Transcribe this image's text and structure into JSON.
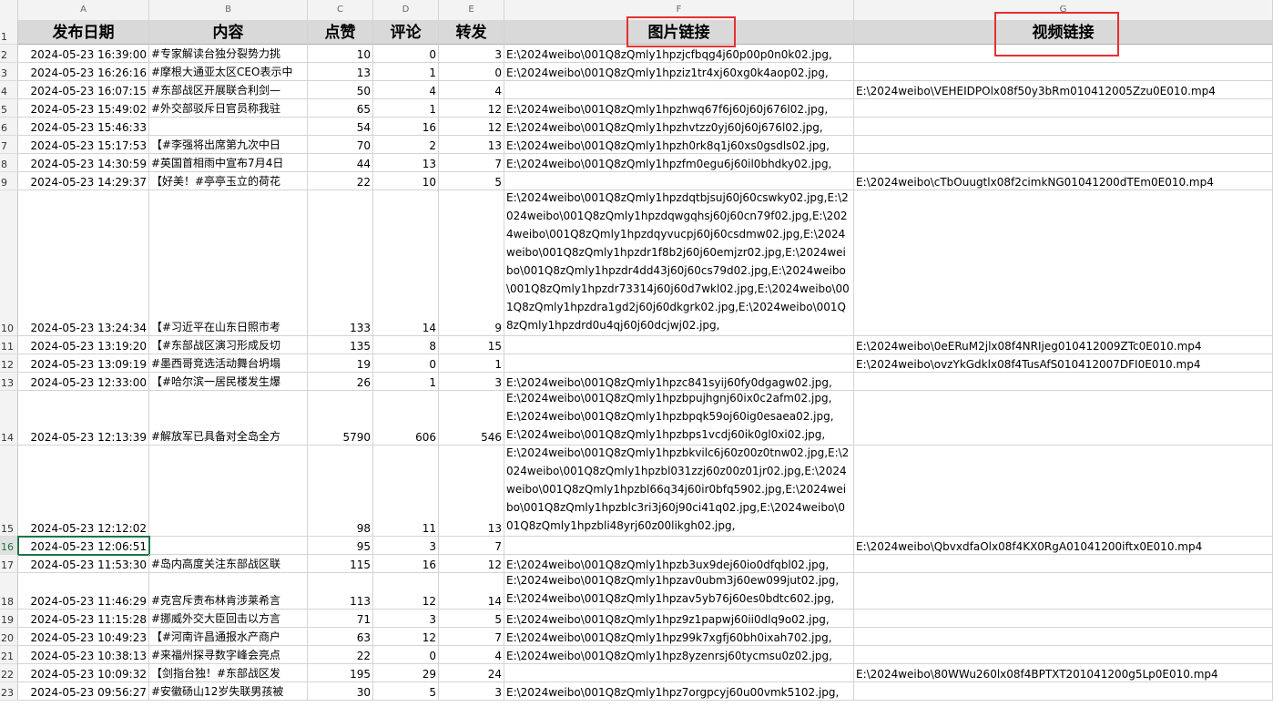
{
  "columns": [
    {
      "letter": "A"
    },
    {
      "letter": "B"
    },
    {
      "letter": "C"
    },
    {
      "letter": "D"
    },
    {
      "letter": "E"
    },
    {
      "letter": "F"
    },
    {
      "letter": "G"
    }
  ],
  "header_row": {
    "row": "1",
    "cells": [
      "发布日期",
      "内容",
      "点赞",
      "评论",
      "转发",
      "图片链接",
      "视频链接"
    ]
  },
  "rows": [
    {
      "row": "2",
      "date": "2024-05-23 16:39:00",
      "content": "#专家解读台独分裂势力挑",
      "likes": "10",
      "comments": "0",
      "reposts": "3",
      "images": "E:\\2024weibo\\001Q8zQmly1hpzjcfbqg4j60p00p0n0k02.jpg,",
      "video": ""
    },
    {
      "row": "3",
      "date": "2024-05-23 16:26:16",
      "content": "#摩根大通亚太区CEO表示中",
      "likes": "13",
      "comments": "1",
      "reposts": "0",
      "images": "E:\\2024weibo\\001Q8zQmly1hpziz1tr4xj60xg0k4aop02.jpg,",
      "video": ""
    },
    {
      "row": "4",
      "date": "2024-05-23 16:07:15",
      "content": "#东部战区开展联合利剑—",
      "likes": "50",
      "comments": "4",
      "reposts": "4",
      "images": "",
      "video": "E:\\2024weibo\\VEHEIDPOlx08f50y3bRm010412005Zzu0E010.mp4"
    },
    {
      "row": "5",
      "date": "2024-05-23 15:49:02",
      "content": "#外交部驳斥日官员称我驻",
      "likes": "65",
      "comments": "1",
      "reposts": "12",
      "images": "E:\\2024weibo\\001Q8zQmly1hpzhwq67f6j60j60j676l02.jpg,",
      "video": ""
    },
    {
      "row": "6",
      "date": "2024-05-23 15:46:33",
      "content": "",
      "likes": "54",
      "comments": "16",
      "reposts": "12",
      "images": "E:\\2024weibo\\001Q8zQmly1hpzhvtzz0yj60j60j676l02.jpg,",
      "video": ""
    },
    {
      "row": "7",
      "date": "2024-05-23 15:17:53",
      "content": "【#李强将出席第九次中日",
      "likes": "70",
      "comments": "2",
      "reposts": "13",
      "images": "E:\\2024weibo\\001Q8zQmly1hpzh0rk8q1j60xs0gsdls02.jpg,",
      "video": ""
    },
    {
      "row": "8",
      "date": "2024-05-23 14:30:59",
      "content": "#英国首相雨中宣布7月4日",
      "likes": "44",
      "comments": "13",
      "reposts": "7",
      "images": "E:\\2024weibo\\001Q8zQmly1hpzfm0egu6j60il0bhdky02.jpg,",
      "video": ""
    },
    {
      "row": "9",
      "date": "2024-05-23 14:29:37",
      "content": "【好美！#亭亭玉立的荷花",
      "likes": "22",
      "comments": "10",
      "reposts": "5",
      "images": "",
      "video": "E:\\2024weibo\\cTbOuugtlx08f2cimkNG01041200dTEm0E010.mp4"
    },
    {
      "row": "10",
      "date": "2024-05-23 13:24:34",
      "content": "【#习近平在山东日照市考",
      "likes": "133",
      "comments": "14",
      "reposts": "9",
      "images": "E:\\2024weibo\\001Q8zQmly1hpzdqtbjsuj60j60cswky02.jpg,E:\\2024weibo\\001Q8zQmly1hpzdqwgqhsj60j60cn79f02.jpg,E:\\2024weibo\\001Q8zQmly1hpzdqyvucpj60j60csdmw02.jpg,E:\\2024weibo\\001Q8zQmly1hpzdr1f8b2j60j60emjzr02.jpg,E:\\2024weibo\\001Q8zQmly1hpzdr4dd43j60j60cs79d02.jpg,E:\\2024weibo\\001Q8zQmly1hpzdr73314j60j60d7wkl02.jpg,E:\\2024weibo\\001Q8zQmly1hpzdra1gd2j60j60dkgrk02.jpg,E:\\2024weibo\\001Q8zQmly1hpzdrd0u4qj60j60dcjwj02.jpg,",
      "video": ""
    },
    {
      "row": "11",
      "date": "2024-05-23 13:19:20",
      "content": "【#东部战区演习形成反切",
      "likes": "135",
      "comments": "8",
      "reposts": "15",
      "images": "",
      "video": "E:\\2024weibo\\0eERuM2jlx08f4NRIjeg010412009ZTc0E010.mp4"
    },
    {
      "row": "12",
      "date": "2024-05-23 13:09:19",
      "content": "#墨西哥竞选活动舞台坍塌",
      "likes": "19",
      "comments": "0",
      "reposts": "1",
      "images": "",
      "video": "E:\\2024weibo\\ovzYkGdklx08f4TusAfS010412007DFI0E010.mp4"
    },
    {
      "row": "13",
      "date": "2024-05-23 12:33:00",
      "content": "【#哈尔滨一居民楼发生爆",
      "likes": "26",
      "comments": "1",
      "reposts": "3",
      "images": "E:\\2024weibo\\001Q8zQmly1hpzc841syij60fy0dgagw02.jpg,",
      "video": ""
    },
    {
      "row": "14",
      "date": "2024-05-23 12:13:39",
      "content": "#解放军已具备对全岛全方",
      "likes": "5790",
      "comments": "606",
      "reposts": "546",
      "images": "E:\\2024weibo\\001Q8zQmly1hpzbpujhgnj60ix0c2afm02.jpg,E:\\2024weibo\\001Q8zQmly1hpzbpqk59oj60ig0esaea02.jpg,E:\\2024weibo\\001Q8zQmly1hpzbps1vcdj60ik0gl0xi02.jpg,",
      "video": ""
    },
    {
      "row": "15",
      "date": "2024-05-23 12:12:02",
      "content": "",
      "likes": "98",
      "comments": "11",
      "reposts": "13",
      "images": "E:\\2024weibo\\001Q8zQmly1hpzbkvilc6j60z00z0tnw02.jpg,E:\\2024weibo\\001Q8zQmly1hpzbl031zzj60z00z01jr02.jpg,E:\\2024weibo\\001Q8zQmly1hpzbl66q34j60ir0bfq5902.jpg,E:\\2024weibo\\001Q8zQmly1hpzblc3ri3j60j90ci41q02.jpg,E:\\2024weibo\\001Q8zQmly1hpzbli48yrj60z00likgh02.jpg,",
      "video": ""
    },
    {
      "row": "16",
      "date": "2024-05-23 12:06:51",
      "content": "",
      "likes": "95",
      "comments": "3",
      "reposts": "7",
      "images": "",
      "video": "E:\\2024weibo\\QbvxdfaOlx08f4KX0RgA01041200iftx0E010.mp4"
    },
    {
      "row": "17",
      "date": "2024-05-23 11:53:30",
      "content": "#岛内高度关注东部战区联",
      "likes": "115",
      "comments": "16",
      "reposts": "12",
      "images": "E:\\2024weibo\\001Q8zQmly1hpzb3ux9dej60io0dfqbl02.jpg,",
      "video": ""
    },
    {
      "row": "18",
      "date": "2024-05-23 11:46:29",
      "content": "#克宫斥责布林肯涉莱希言",
      "likes": "113",
      "comments": "12",
      "reposts": "14",
      "images": "E:\\2024weibo\\001Q8zQmly1hpzav0ubm3j60ew099jut02.jpg,E:\\2024weibo\\001Q8zQmly1hpzav5yb76j60es0bdtc602.jpg,",
      "video": ""
    },
    {
      "row": "19",
      "date": "2024-05-23 11:15:28",
      "content": "#挪威外交大臣回击以方言",
      "likes": "71",
      "comments": "3",
      "reposts": "5",
      "images": "E:\\2024weibo\\001Q8zQmly1hpz9z1papwj60ii0dlq9o02.jpg,",
      "video": ""
    },
    {
      "row": "20",
      "date": "2024-05-23 10:49:23",
      "content": "【#河南许昌通报水产商户",
      "likes": "63",
      "comments": "12",
      "reposts": "7",
      "images": "E:\\2024weibo\\001Q8zQmly1hpz99k7xgfj60bh0ixah702.jpg,",
      "video": ""
    },
    {
      "row": "21",
      "date": "2024-05-23 10:38:13",
      "content": "#来福州探寻数字峰会亮点",
      "likes": "22",
      "comments": "0",
      "reposts": "4",
      "images": "E:\\2024weibo\\001Q8zQmly1hpz8yzenrsj60tycmsu0z02.jpg,",
      "video": ""
    },
    {
      "row": "22",
      "date": "2024-05-23 10:09:32",
      "content": "【剑指台独！#东部战区发",
      "likes": "195",
      "comments": "29",
      "reposts": "24",
      "images": "",
      "video": "E:\\2024weibo\\80WWu260lx08f4BPTXT201041200g5Lp0E010.mp4"
    },
    {
      "row": "23",
      "date": "2024-05-23 09:56:27",
      "content": "#安徽砀山12岁失联男孩被",
      "likes": "30",
      "comments": "5",
      "reposts": "3",
      "images": "E:\\2024weibo\\001Q8zQmly1hpz7orgpcyj60u00vmk5102.jpg,",
      "video": ""
    }
  ],
  "colors": {
    "selected_row": "#217346",
    "annotation": "#e53030",
    "header_fill": "#d9d9d9"
  }
}
